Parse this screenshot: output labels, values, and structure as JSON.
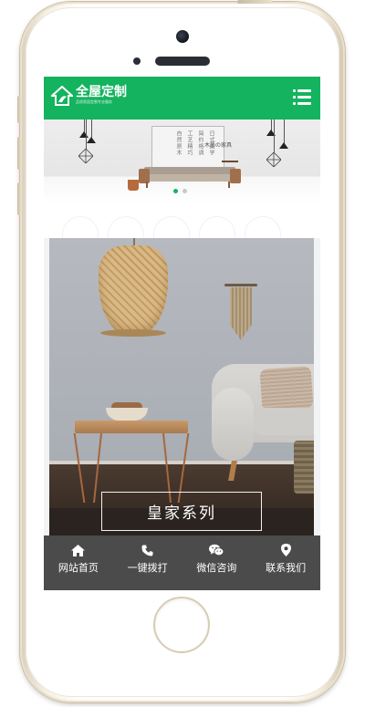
{
  "header": {
    "logo_title": "全屋定制",
    "logo_subtitle": "品质家居定制专业服务"
  },
  "banner": {
    "art_lines": [
      "日式美学",
      "简约格调",
      "工艺精巧",
      "自然原木"
    ],
    "brand_text": "木质の家具",
    "slides": 2,
    "active_slide": 0
  },
  "product": {
    "title": "皇家系列"
  },
  "bottom_nav": {
    "items": [
      {
        "label": "网站首页",
        "icon": "home-icon"
      },
      {
        "label": "一键拨打",
        "icon": "phone-icon"
      },
      {
        "label": "微信咨询",
        "icon": "wechat-icon"
      },
      {
        "label": "联系我们",
        "icon": "location-pin-icon"
      }
    ]
  },
  "colors": {
    "brand_green": "#14b35f",
    "nav_bg": "#444444"
  }
}
